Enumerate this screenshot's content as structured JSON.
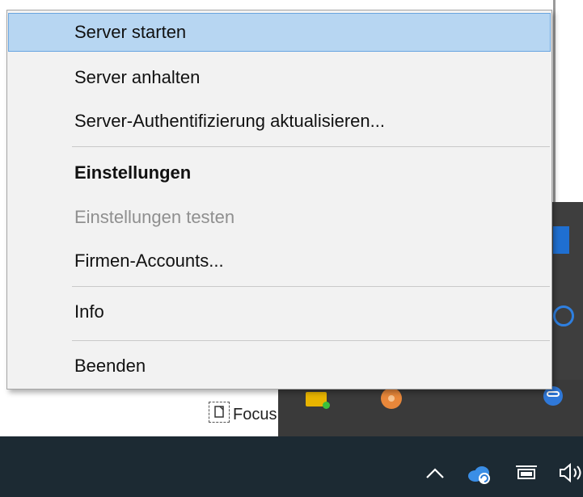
{
  "menu": {
    "items": [
      {
        "label": "Server starten"
      },
      {
        "label": "Server anhalten"
      },
      {
        "label": "Server-Authentifizierung aktualisieren..."
      },
      {
        "label": "Einstellungen"
      },
      {
        "label": "Einstellungen testen"
      },
      {
        "label": "Firmen-Accounts..."
      },
      {
        "label": "Info"
      },
      {
        "label": "Beenden"
      }
    ]
  },
  "background": {
    "focus_label": "Focus"
  },
  "icons": {
    "focus": "focus-assist-icon",
    "tray_chevron": "chevron-up-icon",
    "tray_cloud": "cloud-sync-icon",
    "tray_network": "network-icon",
    "tray_volume": "volume-icon"
  },
  "colors": {
    "menu_background": "#f2f2f2",
    "highlight": "#b7d6f2",
    "highlight_border": "#6aa6e0",
    "disabled_text": "#8f8f8f",
    "taskbar": "#1c2a33"
  }
}
